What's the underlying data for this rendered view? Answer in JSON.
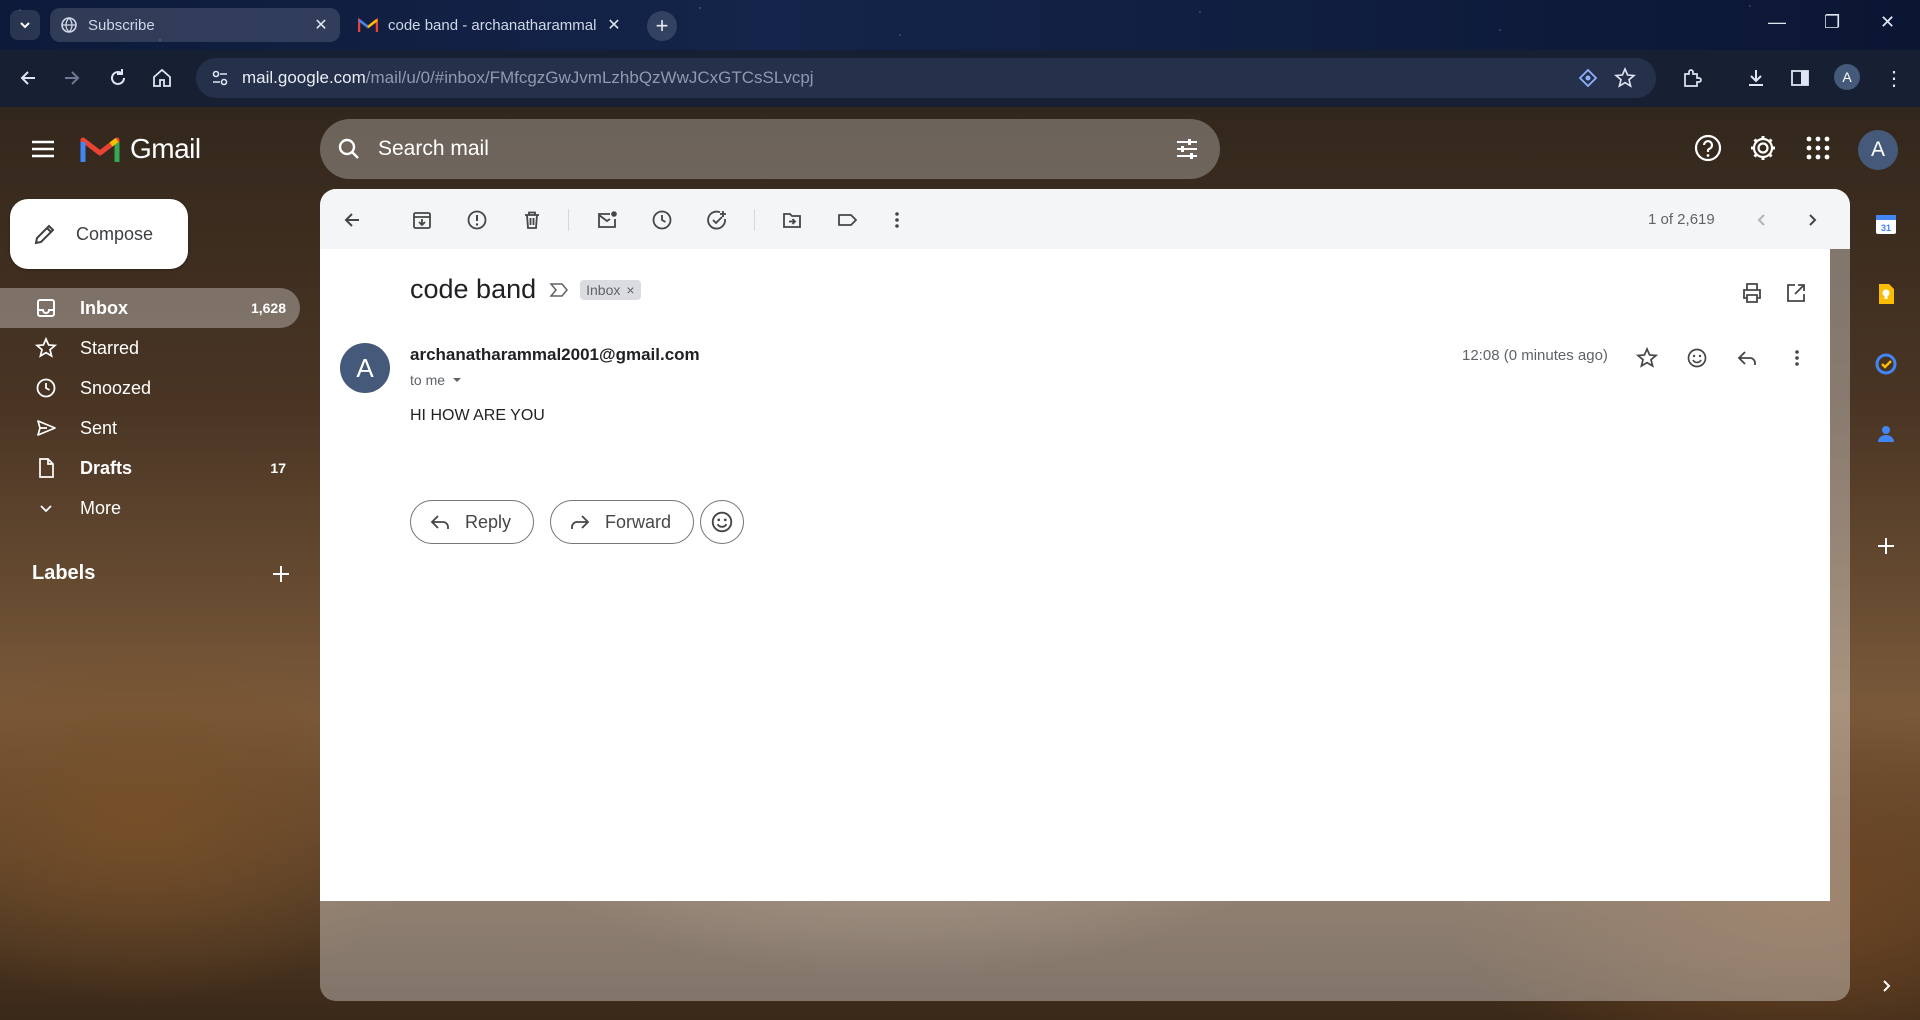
{
  "browser": {
    "tabs": [
      {
        "title": "Subscribe",
        "icon": "globe-icon",
        "active": false
      },
      {
        "title": "code band - archanatharammal",
        "icon": "gmail-icon",
        "active": true
      }
    ],
    "address": {
      "host": "mail.google.com",
      "path": "/mail/u/0/#inbox/FMfcgzGwJvmLzhbQzWwJCxGTCsSLvcpj"
    },
    "profile_initial": "A"
  },
  "gmail": {
    "brand": "Gmail",
    "search_placeholder": "Search mail",
    "account_initial": "A",
    "compose_label": "Compose",
    "nav": [
      {
        "label": "Inbox",
        "count": "1,628",
        "icon": "inbox-icon",
        "selected": true
      },
      {
        "label": "Starred",
        "count": "",
        "icon": "star-icon",
        "selected": false
      },
      {
        "label": "Snoozed",
        "count": "",
        "icon": "clock-icon",
        "selected": false
      },
      {
        "label": "Sent",
        "count": "",
        "icon": "send-icon",
        "selected": false
      },
      {
        "label": "Drafts",
        "count": "17",
        "icon": "draft-icon",
        "selected": false
      },
      {
        "label": "More",
        "count": "",
        "icon": "chevron-down-icon",
        "selected": false
      }
    ],
    "labels_title": "Labels",
    "pager": "1 of 2,619",
    "message": {
      "subject": "code band",
      "label_badge": "Inbox",
      "sender_initial": "A",
      "sender": "archanatharammal2001@gmail.com",
      "to": "to me",
      "time": "12:08 (0 minutes ago)",
      "body": "HI HOW ARE YOU"
    },
    "actions": {
      "reply": "Reply",
      "forward": "Forward"
    },
    "side_panel": {
      "calendar_day": "31"
    }
  },
  "colors": {
    "accent_blue": "#0b57d0",
    "keep_yellow": "#fbbc04",
    "gmail_red": "#ea4335"
  }
}
